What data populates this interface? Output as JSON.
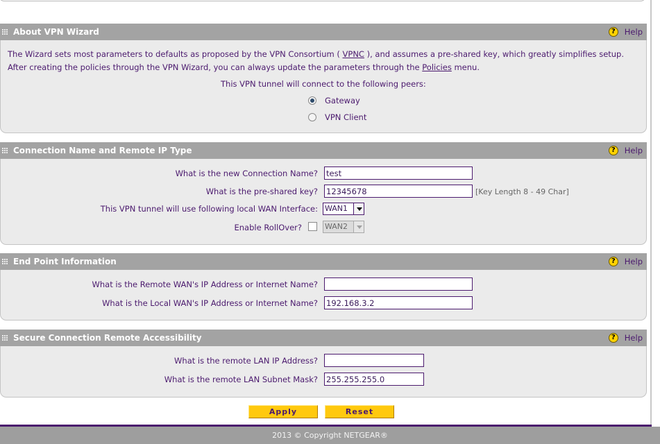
{
  "sections": {
    "about": {
      "title": "About VPN Wizard",
      "help": "Help"
    },
    "connection": {
      "title": "Connection Name and Remote IP Type",
      "help": "Help"
    },
    "endpoint": {
      "title": "End Point Information",
      "help": "Help"
    },
    "secure": {
      "title": "Secure Connection Remote Accessibility",
      "help": "Help"
    }
  },
  "about": {
    "line1_pre": "The Wizard sets most parameters to defaults as proposed by the VPN Consortium ( ",
    "vpnc_link": "VPNC",
    "line1_post": " ), and assumes a pre-shared key, which greatly simplifies setup.",
    "line2_pre": "After creating the policies through the VPN Wizard, you can always update the parameters through the ",
    "policies_link": "Policies",
    "line2_post": " menu.",
    "peers_prompt": "This VPN tunnel will connect to the following peers:",
    "options": [
      {
        "label": "Gateway",
        "selected": true
      },
      {
        "label": "VPN Client",
        "selected": false
      }
    ]
  },
  "connection": {
    "name_label": "What is the new Connection Name?",
    "name_value": "test",
    "key_label": "What is the pre-shared key?",
    "key_value": "12345678",
    "key_hint": "[Key Length 8 - 49 Char]",
    "wan_label": "This VPN tunnel will use following local WAN Interface:",
    "wan_value": "WAN1",
    "rollover_label": "Enable RollOver?",
    "rollover_checked": false,
    "rollover_value": "WAN2"
  },
  "endpoint": {
    "remote_label": "What is the Remote WAN's IP Address or Internet Name?",
    "remote_value": "",
    "local_label": "What is the Local WAN's IP Address or Internet Name?",
    "local_value": "192.168.3.2"
  },
  "secure": {
    "lan_ip_label": "What is the remote LAN IP Address?",
    "lan_ip_value": "",
    "subnet_label": "What is the remote LAN Subnet Mask?",
    "subnet_value": "255.255.255.0"
  },
  "buttons": {
    "apply": "Apply",
    "reset": "Reset"
  },
  "footer": {
    "copyright": "2013 © Copyright NETGEAR®"
  },
  "icons": {
    "help": "help-icon",
    "grip": "grip-icon",
    "dropdown": "chevron-down-icon"
  },
  "colors": {
    "text": "#4b1a6e",
    "header_bg": "#a3a3a3",
    "body_bg": "#ebebeb",
    "button": "#ffc90e",
    "footer_bg": "#9e9e9e"
  }
}
